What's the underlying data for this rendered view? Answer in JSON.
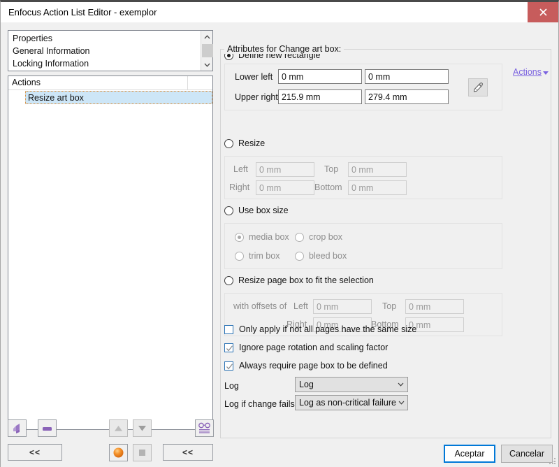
{
  "window": {
    "title": "Enfocus Action List Editor - exemplor",
    "close_icon": "close-icon"
  },
  "properties_list": {
    "items": [
      {
        "label": "Properties"
      },
      {
        "label": "General Information"
      },
      {
        "label": "Locking Information"
      }
    ],
    "scroll_up_icon": "chevron-up-icon",
    "scroll_down_icon": "chevron-down-icon"
  },
  "actions_grid": {
    "header": "Actions",
    "rows": [
      {
        "label": "Resize art box",
        "selected": true
      }
    ]
  },
  "left_toolbar": {
    "add_action_icon": "add-action-icon",
    "remove_action_icon": "remove-action-icon",
    "move_up_icon": "triangle-up-icon",
    "move_down_icon": "triangle-down-icon",
    "preview_icon": "glasses-icon",
    "collapse_left_label": "<<",
    "status_on_icon": "orange-sphere-icon",
    "status_off_icon": "gray-square-icon",
    "collapse_right_label": "<<"
  },
  "attributes": {
    "group_title": "Attributes for Change art box:",
    "actions_link": "Actions",
    "define_new_rectangle": {
      "label": "Define new rectangle",
      "selected": true,
      "lower_left_label": "Lower left",
      "lower_left_x": "0 mm",
      "lower_left_y": "0 mm",
      "upper_right_label": "Upper right",
      "upper_right_x": "215.9 mm",
      "upper_right_y": "279.4 mm",
      "eyedropper_icon": "eyedropper-icon"
    },
    "resize": {
      "label": "Resize",
      "selected": false,
      "left_label": "Left",
      "left_value": "0 mm",
      "top_label": "Top",
      "top_value": "0 mm",
      "right_label": "Right",
      "right_value": "0 mm",
      "bottom_label": "Bottom",
      "bottom_value": "0 mm"
    },
    "use_box_size": {
      "label": "Use box size",
      "selected": false,
      "options": [
        {
          "label": "media box",
          "selected": true
        },
        {
          "label": "crop box",
          "selected": false
        },
        {
          "label": "trim box",
          "selected": false
        },
        {
          "label": "bleed box",
          "selected": false
        }
      ]
    },
    "resize_to_selection": {
      "label": "Resize page box to fit the selection",
      "selected": false,
      "offsets_label": "with offsets of",
      "left_label": "Left",
      "left_value": "0 mm",
      "top_label": "Top",
      "top_value": "0 mm",
      "right_label": "Right",
      "right_value": "0 mm",
      "bottom_label": "Bottom",
      "bottom_value": "0 mm"
    },
    "checkboxes": [
      {
        "label": "Only apply if not all pages have the same size",
        "checked": false
      },
      {
        "label": "Ignore page rotation and scaling factor",
        "checked": true
      },
      {
        "label": "Always require page box to be defined",
        "checked": true
      }
    ],
    "log": {
      "label": "Log",
      "value": "Log"
    },
    "log_if_change_fails": {
      "label": "Log if change fails",
      "value": "Log as non-critical failure"
    }
  },
  "footer": {
    "accept_label": "Aceptar",
    "cancel_label": "Cancelar"
  },
  "colors": {
    "accent": "#7b63e0",
    "selection": "#cde6f7",
    "selection_border": "#e08a2e",
    "default_button_border": "#0078d7",
    "close_button": "#c75c5c"
  }
}
